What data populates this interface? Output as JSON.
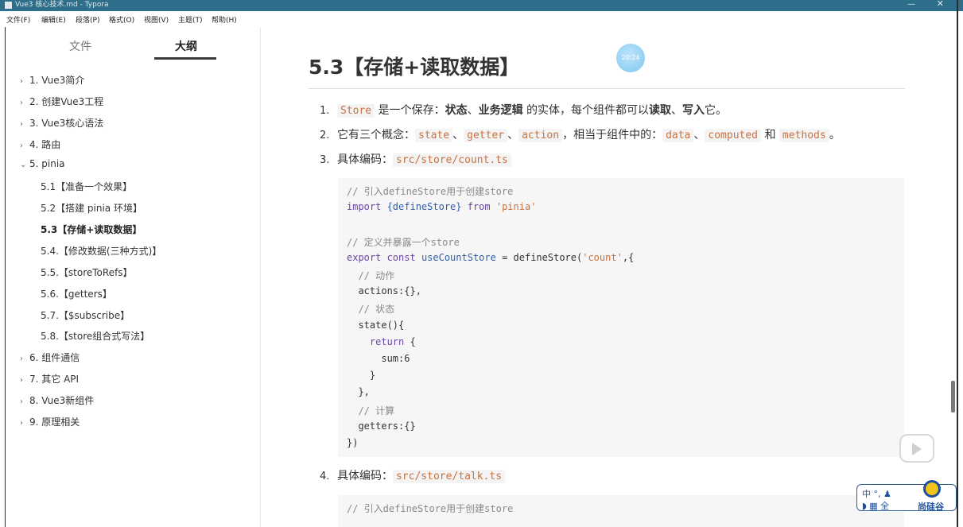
{
  "window": {
    "title": "Vue3 核心技术.md - Typora",
    "minimize": "—",
    "close": "✕"
  },
  "menubar": {
    "items": [
      "文件(F)",
      "编辑(E)",
      "段落(P)",
      "格式(O)",
      "视图(V)",
      "主题(T)",
      "帮助(H)"
    ]
  },
  "sidebar": {
    "tabs": {
      "files": "文件",
      "outline": "大纲"
    },
    "outline": [
      {
        "arrow": "›",
        "label": "1. Vue3简介"
      },
      {
        "arrow": "›",
        "label": "2. 创建Vue3工程"
      },
      {
        "arrow": "›",
        "label": "3. Vue3核心语法"
      },
      {
        "arrow": "›",
        "label": "4. 路由"
      },
      {
        "arrow": "⌄",
        "label": "5. pinia"
      },
      {
        "arrow": "›",
        "label": "6. 组件通信"
      },
      {
        "arrow": "›",
        "label": "7. 其它 API"
      },
      {
        "arrow": "›",
        "label": "8. Vue3新组件"
      },
      {
        "arrow": "›",
        "label": "9. 原理相关"
      }
    ],
    "pinia_children": [
      "5.1【准备一个效果】",
      "5.2【搭建 pinia 环境】",
      "5.3【存储+读取数据】",
      "5.4.【修改数据(三种方式)】",
      "5.5.【storeToRefs】",
      "5.6.【getters】",
      "5.7.【$subscribe】",
      "5.8.【store组合式写法】"
    ],
    "active_index": 2
  },
  "content": {
    "heading": "5.3【存储+读取数据】",
    "clock": "20:24",
    "list": {
      "item1": {
        "num": "1.",
        "code": "Store",
        "t1": " 是一个保存：",
        "b1": "状态",
        "t2": "、",
        "b2": "业务逻辑",
        "t3": " 的实体，每个组件都可以",
        "b3": "读取",
        "t4": "、",
        "b4": "写入",
        "t5": "它。"
      },
      "item2": {
        "num": "2.",
        "t1": "它有三个概念：",
        "c1": "state",
        "s1": "、",
        "c2": "getter",
        "s2": "、",
        "c3": "action",
        "t2": "，相当于组件中的：",
        "c4": "data",
        "s3": "、",
        "c5": "computed",
        "t3": " 和 ",
        "c6": "methods",
        "t4": "。"
      },
      "item3": {
        "num": "3.",
        "text": "具体编码：",
        "code": "src/store/count.ts"
      },
      "item4": {
        "num": "4.",
        "text": "具体编码：",
        "code": "src/store/talk.ts"
      }
    },
    "code_count": [
      [
        {
          "t": "// 引入defineStore用于创建store",
          "c": "comment"
        }
      ],
      [
        {
          "t": "import ",
          "c": "kw"
        },
        {
          "t": "{defineStore}",
          "c": "fn"
        },
        {
          "t": " from ",
          "c": "kw"
        },
        {
          "t": "'pinia'",
          "c": "str"
        }
      ],
      [],
      [
        {
          "t": "// 定义并暴露一个store",
          "c": "comment"
        }
      ],
      [
        {
          "t": "export ",
          "c": "kw"
        },
        {
          "t": "const ",
          "c": "kw"
        },
        {
          "t": "useCountStore",
          "c": "fn"
        },
        {
          "t": " = defineStore(",
          "c": "plain"
        },
        {
          "t": "'count'",
          "c": "str"
        },
        {
          "t": ",{",
          "c": "plain"
        }
      ],
      [
        {
          "t": "  // 动作",
          "c": "comment"
        }
      ],
      [
        {
          "t": "  actions:{},",
          "c": "plain"
        }
      ],
      [
        {
          "t": "  // 状态",
          "c": "comment"
        }
      ],
      [
        {
          "t": "  state(){",
          "c": "plain"
        }
      ],
      [
        {
          "t": "    return ",
          "c": "kw"
        },
        {
          "t": "{",
          "c": "plain"
        }
      ],
      [
        {
          "t": "      sum:",
          "c": "plain"
        },
        {
          "t": "6",
          "c": "plain"
        }
      ],
      [
        {
          "t": "    }",
          "c": "plain"
        }
      ],
      [
        {
          "t": "  },",
          "c": "plain"
        }
      ],
      [
        {
          "t": "  // 计算",
          "c": "comment"
        }
      ],
      [
        {
          "t": "  getters:{}",
          "c": "plain"
        }
      ],
      [
        {
          "t": "})",
          "c": "plain"
        }
      ]
    ],
    "code_talk_first_line": "// 引入defineStore用于创建store"
  },
  "overlays": {
    "ime_line1": "中 °, ♟",
    "ime_line2": "◗ ▦ 全",
    "ime_brand": "尚硅谷"
  },
  "colors": {
    "titlebar": "#2d6e8a",
    "code_inline": "#c9713f",
    "keyword": "#6b46a8",
    "string": "#c9713f",
    "comment": "#8a8a8a"
  }
}
